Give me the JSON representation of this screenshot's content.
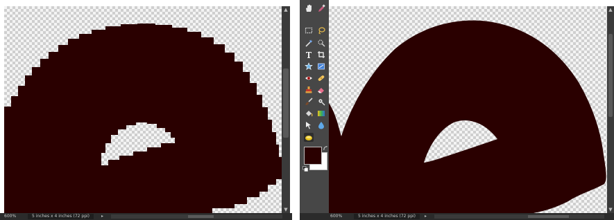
{
  "left_window": {
    "zoom": "600%",
    "doc_info": "5 inches x 4 inches (72 ppi)"
  },
  "right_window": {
    "zoom": "600%",
    "doc_info": "5 inches x 4 inches (72 ppi)"
  },
  "toolbox": {
    "tools": [
      "hand-tool-icon",
      "zoom-tool-icon",
      "eyedropper-tool-icon",
      "marquee-tool-icon",
      "lasso-tool-icon",
      "magic-wand-tool-icon",
      "quick-selection-tool-icon",
      "type-tool-icon",
      "crop-tool-icon",
      "cookie-cutter-tool-icon",
      "straighten-tool-icon",
      "red-eye-tool-icon",
      "spot-healing-tool-icon",
      "clone-stamp-tool-icon",
      "eraser-tool-icon",
      "brush-tool-icon",
      "smart-brush-tool-icon",
      "paint-bucket-tool-icon",
      "gradient-tool-icon",
      "custom-shape-tool-icon",
      "blur-tool-icon",
      "sponge-tool-icon"
    ],
    "foreground_color": "#2a0000",
    "background_color": "#ffffff"
  },
  "colors": {
    "ink": "#2a0000",
    "panel": "#474747",
    "statusbar": "#2b2b2b"
  }
}
